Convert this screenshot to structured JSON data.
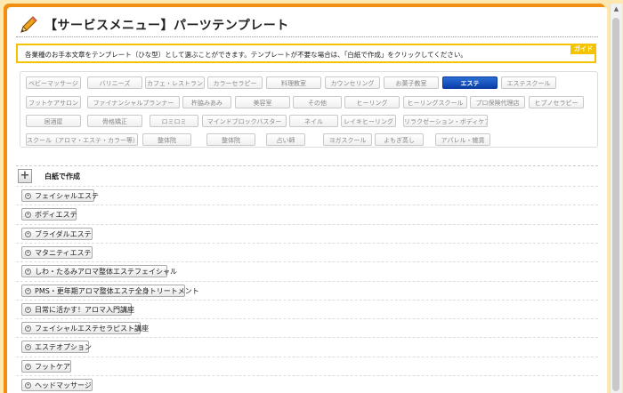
{
  "title": "【サービスメニュー】パーツテンプレート",
  "notice": {
    "text": "各業種のお手本文章をテンプレート（ひな型）として選ぶことができます。テンプレートが不要な場合は、「白紙で作成」をクリックしてください。",
    "guide_label": "ガイド"
  },
  "categories": [
    {
      "label": "ベビーマッサージ",
      "active": false
    },
    {
      "label": "バリニーズ",
      "active": false
    },
    {
      "label": "カフェ・レストラン",
      "active": false
    },
    {
      "label": "カラーセラピー",
      "active": false
    },
    {
      "label": "料理教室",
      "active": false
    },
    {
      "label": "カウンセリング",
      "active": false
    },
    {
      "label": "お菓子教室",
      "active": false
    },
    {
      "label": "エステ",
      "active": true
    },
    {
      "label": "エステスクール",
      "active": false
    },
    {
      "label": "フットケアサロン",
      "active": false
    },
    {
      "label": "ファイナンシャルプランナー",
      "active": false
    },
    {
      "label": "杵脇みあみ",
      "active": false
    },
    {
      "label": "美容室",
      "active": false
    },
    {
      "label": "その他",
      "active": false
    },
    {
      "label": "ヒーリング",
      "active": false
    },
    {
      "label": "ヒーリングスクール",
      "active": false
    },
    {
      "label": "プロ保険代理店",
      "active": false
    },
    {
      "label": "ヒプノセラピー",
      "active": false
    },
    {
      "label": "居酒屋",
      "active": false
    },
    {
      "label": "骨格矯正",
      "active": false
    },
    {
      "label": "ロミロミ",
      "active": false
    },
    {
      "label": "マインドブロックバスター",
      "active": false
    },
    {
      "label": "ネイル",
      "active": false
    },
    {
      "label": "レイキヒーリング",
      "active": false
    },
    {
      "label": "リラクゼーション・ボディケア",
      "active": false
    },
    {
      "label": "スクール（アロマ・エステ・カラー等）",
      "active": false
    },
    {
      "label": "整体院",
      "active": false
    },
    {
      "label": "整体院",
      "active": false
    },
    {
      "label": "占い師",
      "active": false
    },
    {
      "label": "ヨガスクール",
      "active": false
    },
    {
      "label": "よもぎ蒸し",
      "active": false
    },
    {
      "label": "アパレル・雑貨",
      "active": false
    }
  ],
  "blank": {
    "label": "白紙で作成"
  },
  "templates": [
    {
      "label": "フェイシャルエステ"
    },
    {
      "label": "ボディエステ"
    },
    {
      "label": "ブライダルエステ"
    },
    {
      "label": "マタニティエステ"
    },
    {
      "label": "しわ・たるみアロマ整体エステフェイシャル"
    },
    {
      "label": "PMS・更年期アロマ整体エステ全身トリートメント"
    },
    {
      "label": "日常に活かす！アロマ入門講座"
    },
    {
      "label": "フェイシャルエステセラピスト講座"
    },
    {
      "label": "エステオプション"
    },
    {
      "label": "フットケア"
    },
    {
      "label": "ヘッドマッサージ"
    }
  ]
}
